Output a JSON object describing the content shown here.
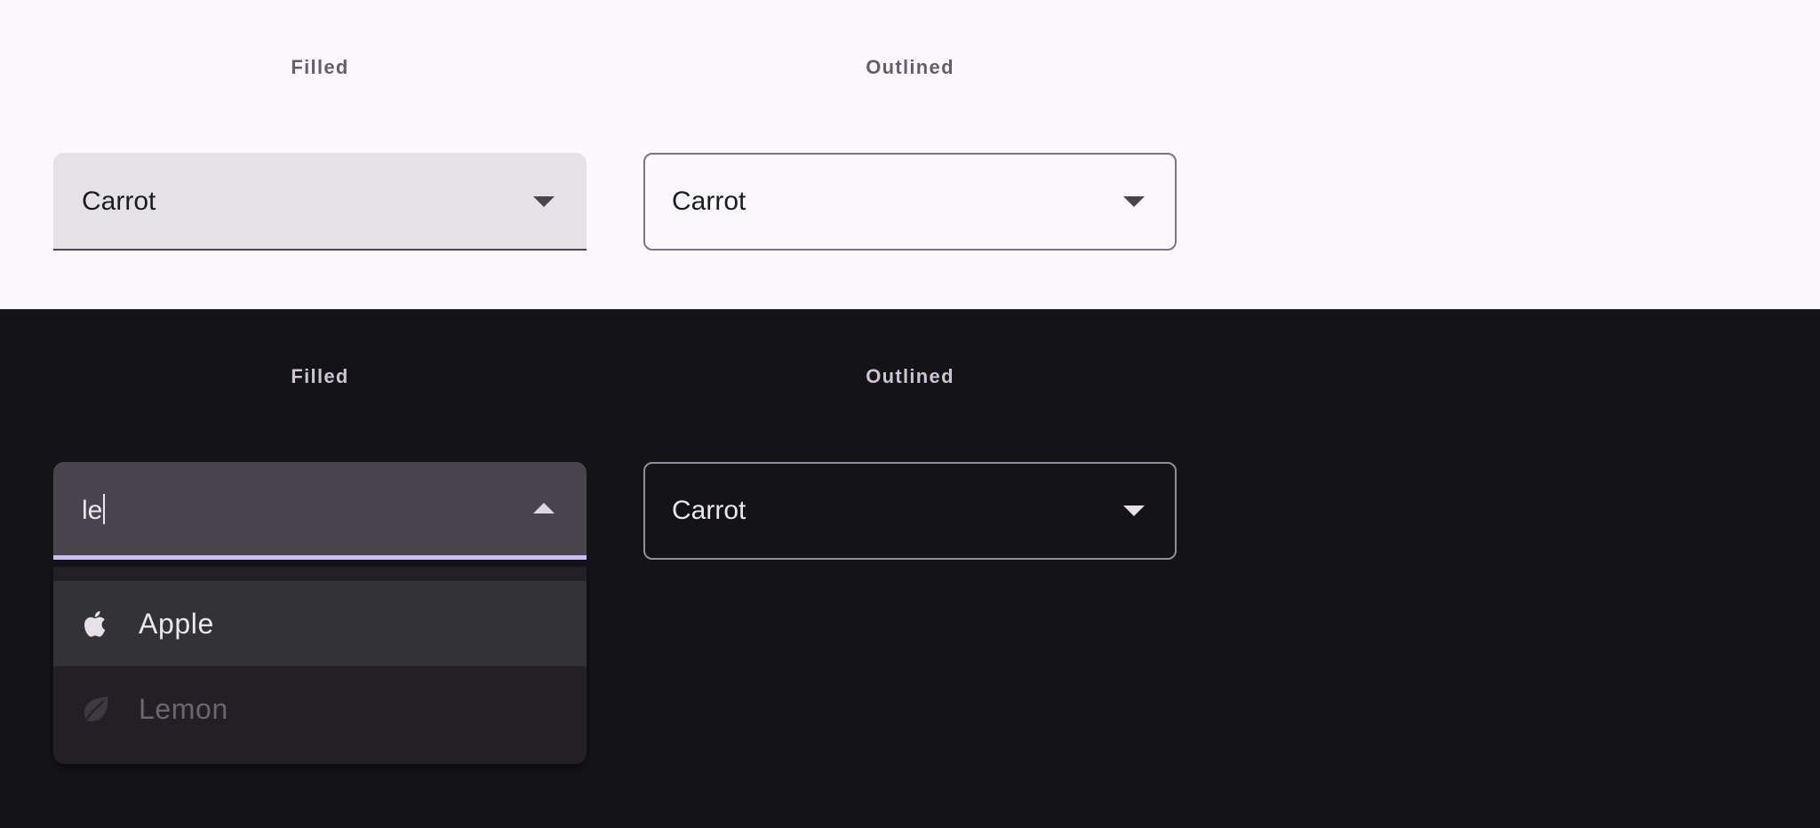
{
  "light_panel": {
    "filled_label": "Filled",
    "outlined_label": "Outlined",
    "filled_value": "Carrot",
    "outlined_value": "Carrot"
  },
  "dark_panel": {
    "filled_label": "Filled",
    "outlined_label": "Outlined",
    "filled_input": "le",
    "outlined_value": "Carrot",
    "menu": {
      "items": [
        {
          "label": "Apple",
          "icon": "apple-icon",
          "state": "hovered"
        },
        {
          "label": "Lemon",
          "icon": "leaf-icon",
          "state": "disabled"
        }
      ]
    }
  },
  "colors": {
    "light_bg": "#faf8fb",
    "dark_bg": "#141316",
    "focus_indicator": "#cbbdf8"
  }
}
